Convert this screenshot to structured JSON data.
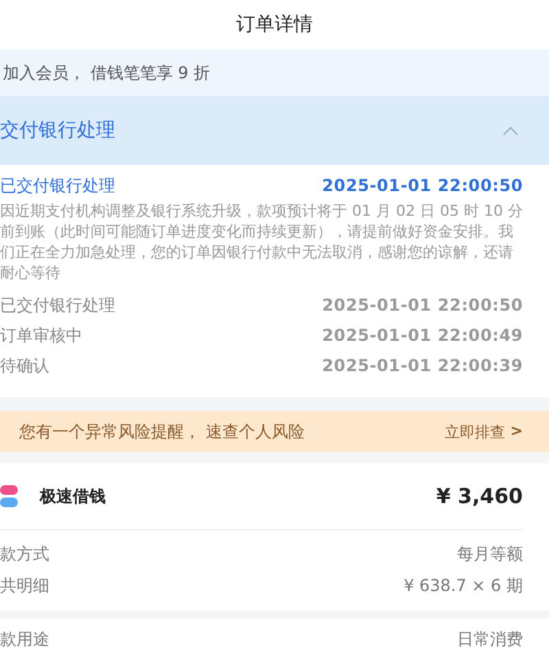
{
  "header": {
    "title": "订单详情"
  },
  "member_banner": {
    "text": "加入会员， 借钱笔笔享 9 折"
  },
  "status_panel": {
    "title": "交付银行处理",
    "expanded": true
  },
  "timeline": [
    {
      "label": "已交付银行处理",
      "time": "2025-01-01 22:00:50",
      "selected": true,
      "description": "因近期支付机构调整及银行系统升级，款项预计将于 01 月 02 日 05 时 10 分前到账（此时间可能随订单进度变化而持续更新），请提前做好资金安排。我们正在全力加急处理，您的订单因银行付款中无法取消，感谢您的谅解，还请耐心等待"
    },
    {
      "label": "已交付银行处理",
      "time": "2025-01-01 22:00:50",
      "selected": false
    },
    {
      "label": "订单审核中",
      "time": "2025-01-01 22:00:49",
      "selected": false
    },
    {
      "label": "待确认",
      "time": "2025-01-01 22:00:39",
      "selected": false
    }
  ],
  "risk_banner": {
    "text": "您有一个异常风险提醒， 速查个人风险",
    "action": "立即排查",
    "arrow": ">"
  },
  "loan": {
    "name": "极速借钱",
    "amount": "¥ 3,460"
  },
  "details": [
    {
      "label": "款方式",
      "value": "每月等额"
    },
    {
      "label": "共明细",
      "value": "¥ 638.7 × 6 期"
    }
  ],
  "extra_details": [
    {
      "label": "款用途",
      "value": "日常消费"
    }
  ]
}
